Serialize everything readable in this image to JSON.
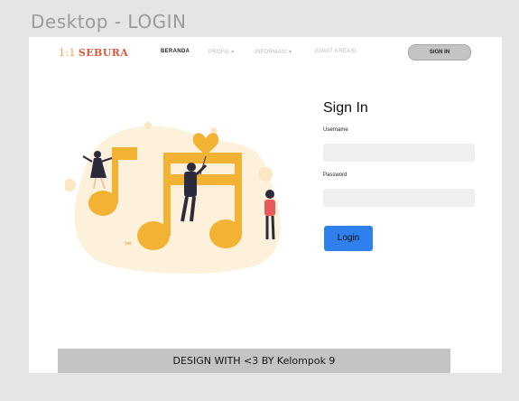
{
  "frame": {
    "title": "Desktop - LOGIN"
  },
  "nav": {
    "logo": "SEBURA",
    "logo_mark": "1:1",
    "links": [
      {
        "label": "BERANDA",
        "active": true
      },
      {
        "label": "PROFIL ▾",
        "active": false
      },
      {
        "label": "INFORMASI ▾",
        "active": false
      },
      {
        "label": "JUMAT KREASI",
        "active": false
      }
    ],
    "signin_label": "SIGN IN"
  },
  "form": {
    "title": "Sign In",
    "username_label": "Username",
    "username_value": "",
    "password_label": "Password",
    "password_value": "",
    "submit_label": "Login"
  },
  "footer": {
    "text": "DESIGN WITH <3 BY Kelompok 9"
  },
  "colors": {
    "accent": "#2f80ed",
    "brand": "#d65a3a",
    "illustration_note": "#f2b233",
    "illustration_blob": "#fdf3e2"
  }
}
